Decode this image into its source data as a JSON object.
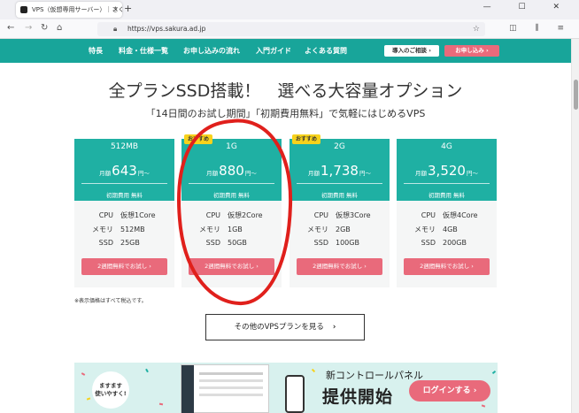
{
  "browser": {
    "tab_title": "VPS（仮想専用サーバー）｜さくらの",
    "tab_close": "×",
    "new_tab": "+",
    "window_controls": "—  ☐  ✕",
    "url": "https://vps.sakura.ad.jp",
    "nav_icons": [
      "back-arrow-icon",
      "forward-arrow-icon",
      "reload-icon",
      "home-icon"
    ],
    "toolbar_icons": "◫ ⫼ ≡"
  },
  "sitenav": {
    "items": [
      "特長",
      "料金・仕様一覧",
      "お申し込みの流れ",
      "入門ガイド",
      "よくある質問"
    ],
    "login_button": "導入のご相談 ›",
    "apply_button": "お申し込み ›",
    "accent": "#18a59a",
    "cta_color": "#e96a7b"
  },
  "hero": {
    "title": "全プランSSD搭載！　選べる大容量オプション",
    "subtitle": "「14日間のお試し期間」「初期費用無料」で気軽にはじめるVPS"
  },
  "plans": [
    {
      "name": "512MB",
      "price_prefix": "月額",
      "price": "643",
      "price_suffix": "円〜",
      "initial_fee": "初期費用 無料",
      "cpu_label": "CPU",
      "cpu": "仮想1Core",
      "mem_label": "メモリ",
      "mem": "512MB",
      "ssd_label": "SSD",
      "ssd": "25GB",
      "cta": "2週間無料でお試し ›"
    },
    {
      "name": "1G",
      "price_prefix": "月額",
      "price": "880",
      "price_suffix": "円〜",
      "initial_fee": "初期費用 無料",
      "cpu_label": "CPU",
      "cpu": "仮想2Core",
      "mem_label": "メモリ",
      "mem": "1GB",
      "ssd_label": "SSD",
      "ssd": "50GB",
      "cta": "2週間無料でお試し ›",
      "badge": "おすすめ"
    },
    {
      "name": "2G",
      "price_prefix": "月額",
      "price": "1,738",
      "price_suffix": "円〜",
      "initial_fee": "初期費用 無料",
      "cpu_label": "CPU",
      "cpu": "仮想3Core",
      "mem_label": "メモリ",
      "mem": "2GB",
      "ssd_label": "SSD",
      "ssd": "100GB",
      "cta": "2週間無料でお試し ›",
      "badge": "おすすめ"
    },
    {
      "name": "4G",
      "price_prefix": "月額",
      "price": "3,520",
      "price_suffix": "円〜",
      "initial_fee": "初期費用 無料",
      "cpu_label": "CPU",
      "cpu": "仮想4Core",
      "mem_label": "メモリ",
      "mem": "4GB",
      "ssd_label": "SSD",
      "ssd": "200GB",
      "cta": "2週間無料でお試し ›"
    }
  ],
  "note": "※表示価格はすべて税込です。",
  "more_plans": {
    "label": "その他のVPSプランを見る",
    "chevron": "›"
  },
  "banner": {
    "bubble_line1": "ますます",
    "bubble_line2": "使いやすく!",
    "title_small": "新コントロールパネル",
    "title_big": "提供開始",
    "login_label": "ログインする ›"
  },
  "annotation": {
    "shape": "hand-drawn red ellipse around 1G plan",
    "color": "#e0201c"
  }
}
